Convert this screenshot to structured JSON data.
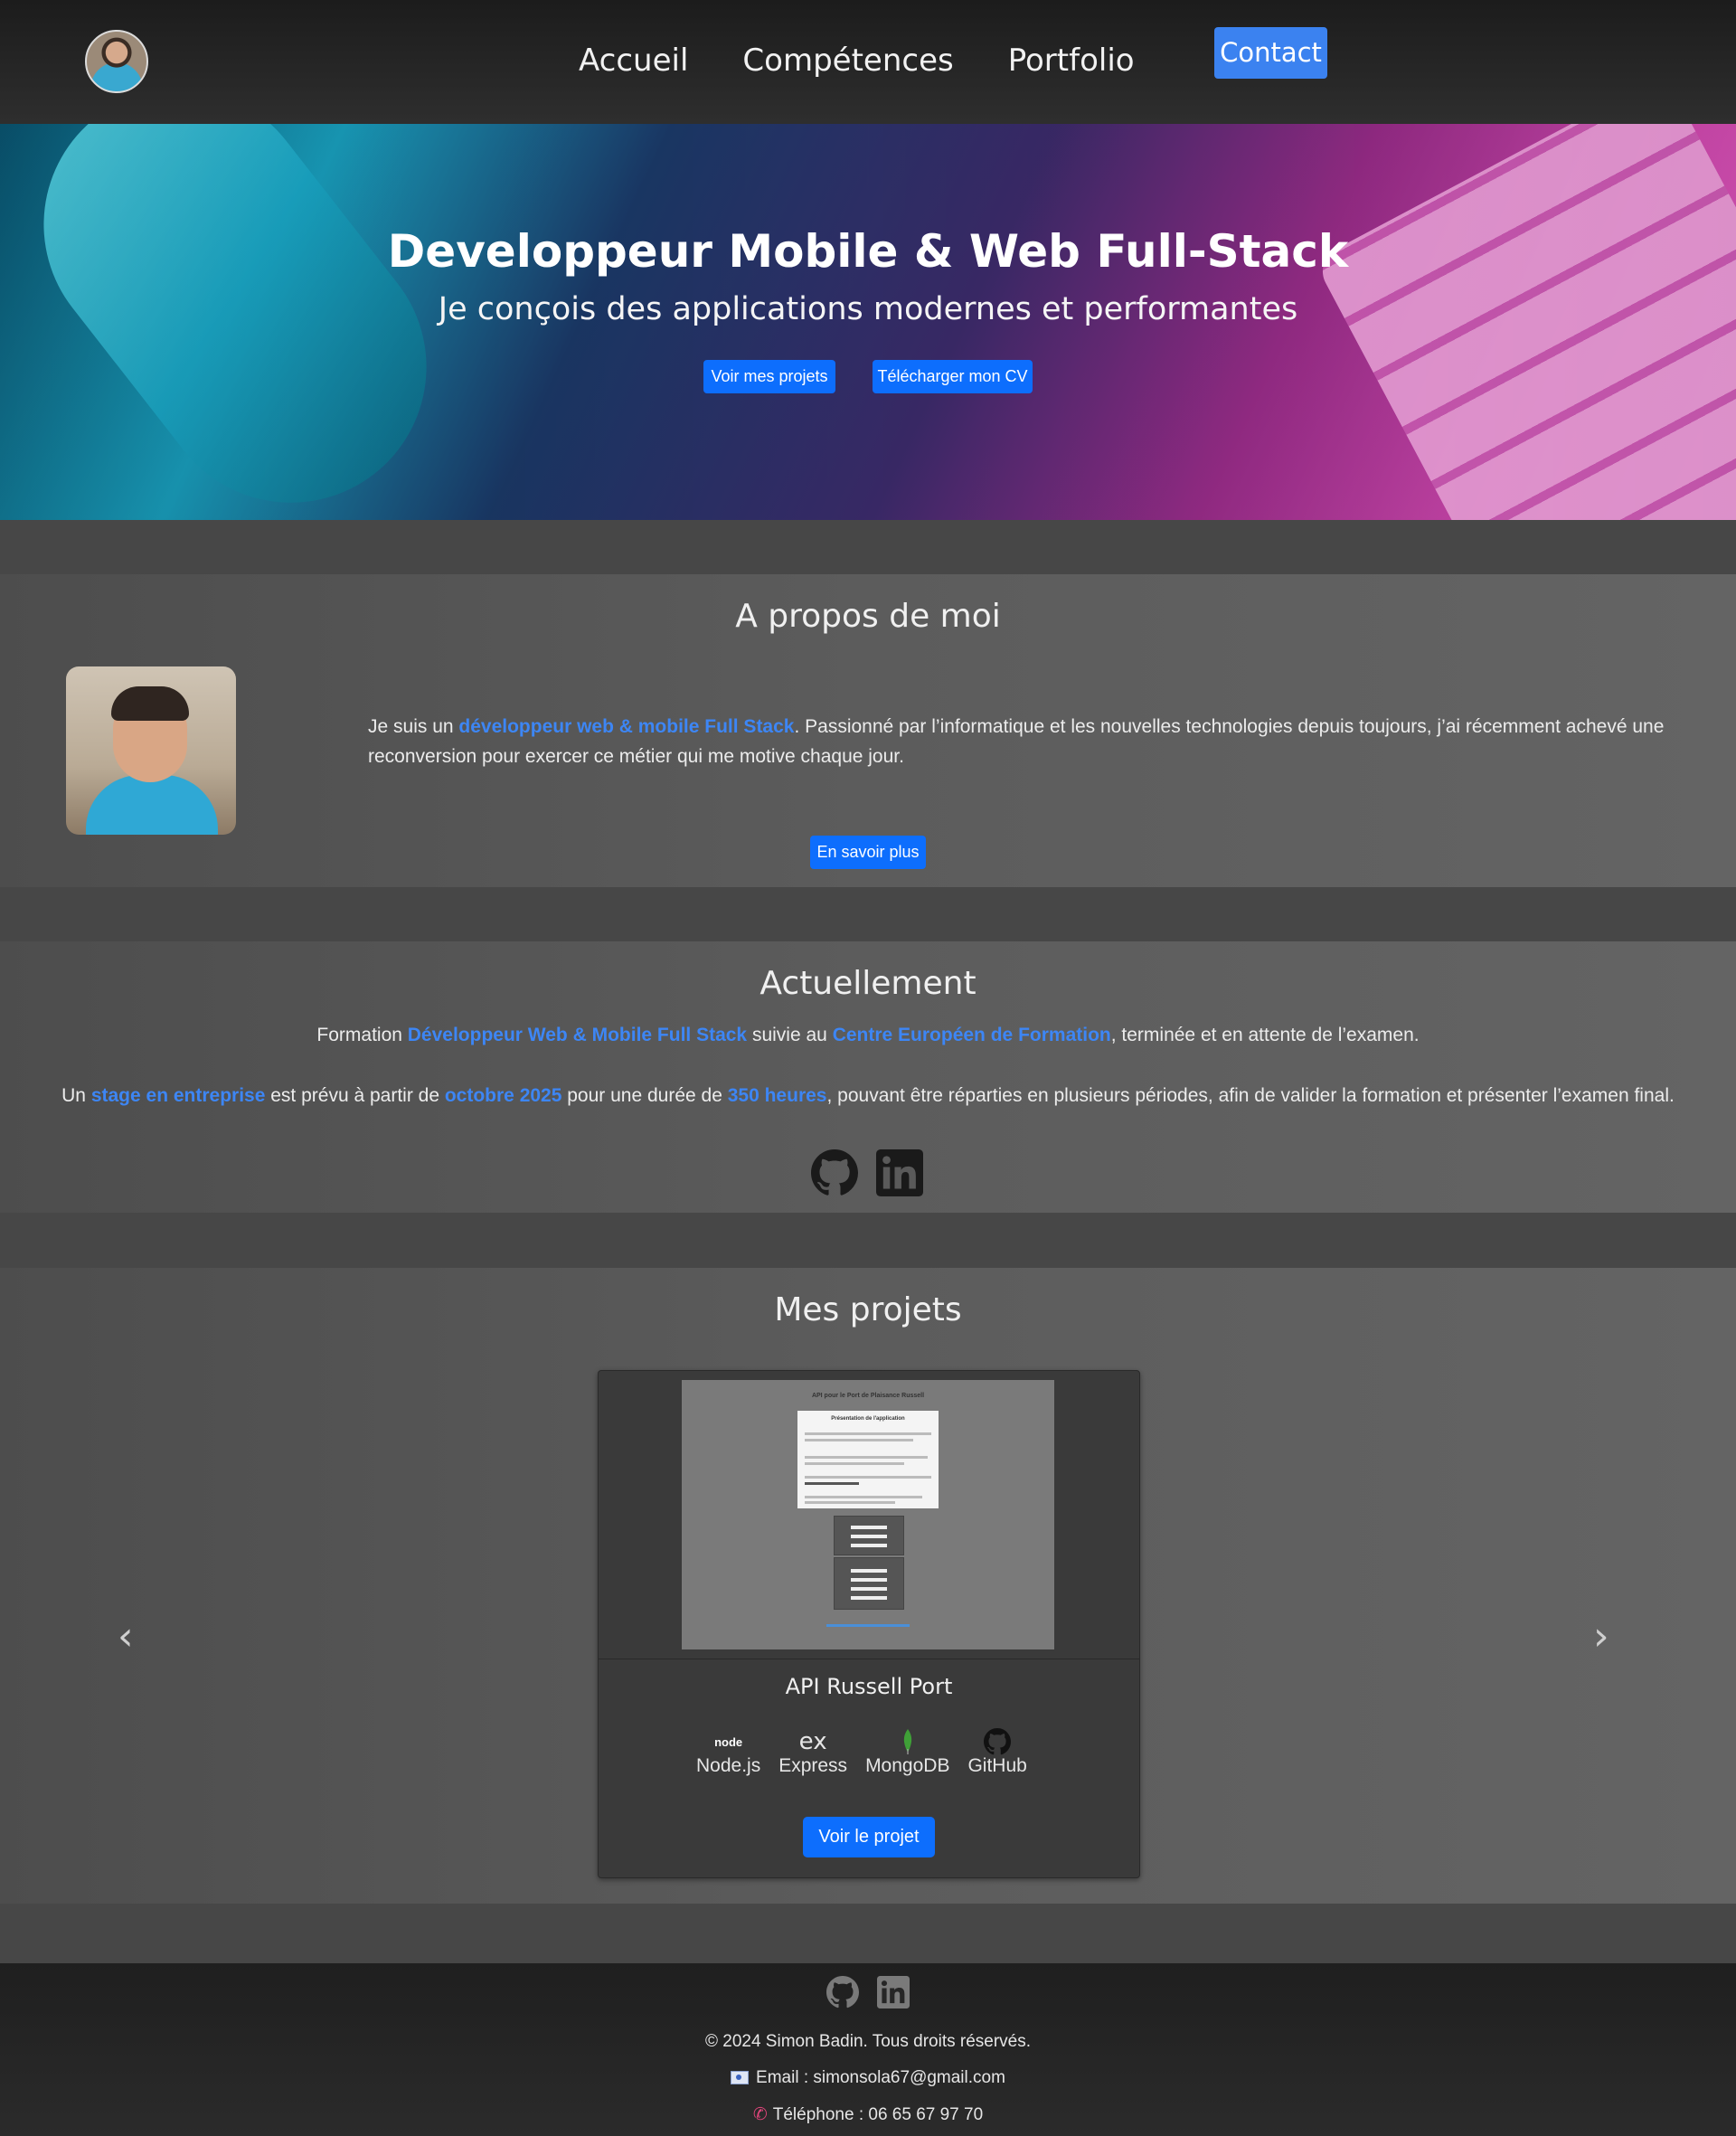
{
  "nav": {
    "links": [
      "Accueil",
      "Compétences",
      "Portfolio"
    ],
    "contact": "Contact"
  },
  "hero": {
    "title": "Developpeur Mobile & Web Full-Stack",
    "subtitle": "Je conçois des applications modernes et performantes",
    "btn_projects": "Voir mes projets",
    "btn_cv": "Télécharger mon CV"
  },
  "about": {
    "title": "A propos de moi",
    "text_pre": "Je suis un ",
    "text_hl": "développeur web & mobile Full Stack",
    "text_post": ". Passionné par l’informatique et les nouvelles technologies depuis toujours, j’ai récemment achevé une reconversion pour exercer ce métier qui me motive chaque jour.",
    "button": "En savoir plus"
  },
  "current": {
    "title": "Actuellement",
    "p1": [
      "Formation ",
      "Développeur Web & Mobile Full Stack",
      " suivie au ",
      "Centre Européen de Formation",
      ", terminée et en attente de l’examen."
    ],
    "p2": [
      "Un ",
      "stage en entreprise",
      " est prévu à partir de ",
      "octobre 2025",
      " pour une durée de ",
      "350 heures",
      ", pouvant être réparties en plusieurs périodes, afin de valider la formation et présenter l’examen final."
    ]
  },
  "projects": {
    "title": "Mes projets",
    "card": {
      "screenshot_title": "API pour le Port de Plaisance Russell",
      "screenshot_box_title": "Présentation de l'application",
      "name": "API Russell Port",
      "techs": [
        "Node.js",
        "Express",
        "MongoDB",
        "GitHub"
      ],
      "button": "Voir le projet"
    },
    "prev": "‹",
    "next": "›"
  },
  "footer": {
    "copyright": "© 2024 Simon Badin. Tous droits réservés.",
    "email": "Email : simonsola67@gmail.com",
    "phone": "Téléphone : 06 65 67 97 70"
  },
  "colors": {
    "accent": "#0d6efd",
    "highlight": "#3d86f5"
  }
}
